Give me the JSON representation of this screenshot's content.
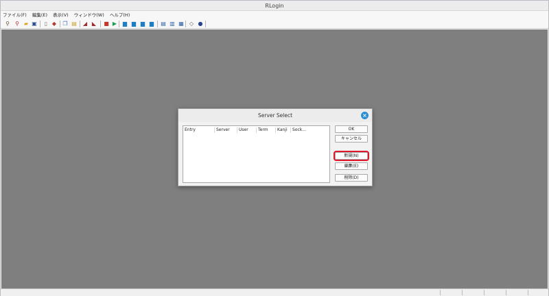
{
  "window": {
    "title": "RLogin"
  },
  "menu": [
    {
      "id": "file",
      "label": "ファイル(F)"
    },
    {
      "id": "edit",
      "label": "編集(E)"
    },
    {
      "id": "view",
      "label": "表示(V)"
    },
    {
      "id": "window",
      "label": "ウィンドウ(W)"
    },
    {
      "id": "help",
      "label": "ヘルプ(H)"
    }
  ],
  "toolbar": {
    "icons": [
      {
        "name": "connect-icon",
        "glyph": "⚲",
        "color": "#6b4f2a"
      },
      {
        "name": "disconnect-icon",
        "glyph": "⚲",
        "color": "#b0312b"
      },
      {
        "name": "open-folder-icon",
        "glyph": "▰",
        "color": "#d8a520"
      },
      {
        "name": "save-icon",
        "glyph": "▣",
        "color": "#2a4b8f"
      },
      {
        "name": "new-document-icon",
        "glyph": "▯",
        "color": "#777777"
      },
      {
        "name": "print-icon",
        "glyph": "◆",
        "color": "#b03a2e"
      },
      {
        "name": "copy-icon",
        "glyph": "❐",
        "color": "#4a6fb0"
      },
      {
        "name": "paste-icon",
        "glyph": "▤",
        "color": "#c9a227"
      },
      {
        "name": "key-icon",
        "glyph": "◢",
        "color": "#a52a2a"
      },
      {
        "name": "screen-icon",
        "glyph": "◣",
        "color": "#a52a2a"
      },
      {
        "name": "stop-icon",
        "glyph": "■",
        "color": "#c0392b"
      },
      {
        "name": "play-icon",
        "glyph": "▶",
        "color": "#1f9d55"
      },
      {
        "name": "font-size-1-icon",
        "glyph": "▆",
        "color": "#1c7fc4"
      },
      {
        "name": "font-size-2-icon",
        "glyph": "▆",
        "color": "#1c7fc4"
      },
      {
        "name": "font-size-3-icon",
        "glyph": "▆",
        "color": "#1c7fc4"
      },
      {
        "name": "font-size-4-icon",
        "glyph": "▆",
        "color": "#1c7fc4"
      },
      {
        "name": "split-horizontal-icon",
        "glyph": "▤",
        "color": "#2d5fa8"
      },
      {
        "name": "split-vertical-icon",
        "glyph": "▥",
        "color": "#2d5fa8"
      },
      {
        "name": "split-grid-icon",
        "glyph": "▦",
        "color": "#2d5fa8"
      },
      {
        "name": "cube-icon",
        "glyph": "◇",
        "color": "#555555"
      },
      {
        "name": "about-icon",
        "glyph": "●",
        "color": "#27438f"
      }
    ]
  },
  "dialog": {
    "title": "Server Select",
    "columns": [
      "Entry",
      "Server",
      "User",
      "Term",
      "Kanji",
      "Sock..."
    ],
    "buttons": {
      "ok": "OK",
      "cancel": "キャンセル",
      "new": "新規(N)",
      "edit": "編集(E)",
      "delete": "削除(D)"
    },
    "highlight_color": "#e0162b"
  }
}
